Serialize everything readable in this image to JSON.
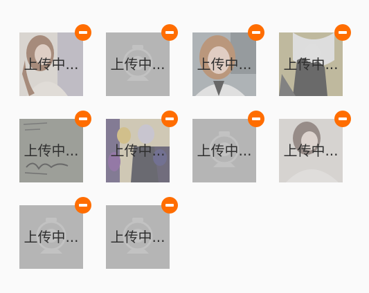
{
  "status_label": "上传中...",
  "accent_color": "#ff6d00",
  "remove_icon": "minus-circle-icon",
  "images": [
    {
      "kind": "photo-girl-light-dress",
      "placeholder_icon": "upload-placeholder-icon"
    },
    {
      "kind": "placeholder",
      "placeholder_icon": "upload-placeholder-icon"
    },
    {
      "kind": "photo-girl-car-selfie",
      "placeholder_icon": "upload-placeholder-icon"
    },
    {
      "kind": "anime-white-hair-dark",
      "placeholder_icon": "upload-placeholder-icon"
    },
    {
      "kind": "handwriting-note",
      "placeholder_icon": "upload-placeholder-icon"
    },
    {
      "kind": "anime-group",
      "placeholder_icon": "upload-placeholder-icon"
    },
    {
      "kind": "placeholder",
      "placeholder_icon": "upload-placeholder-icon"
    },
    {
      "kind": "photo-girl-faded",
      "placeholder_icon": "upload-placeholder-icon"
    },
    {
      "kind": "placeholder",
      "placeholder_icon": "upload-placeholder-icon"
    },
    {
      "kind": "placeholder",
      "placeholder_icon": "upload-placeholder-icon"
    }
  ]
}
